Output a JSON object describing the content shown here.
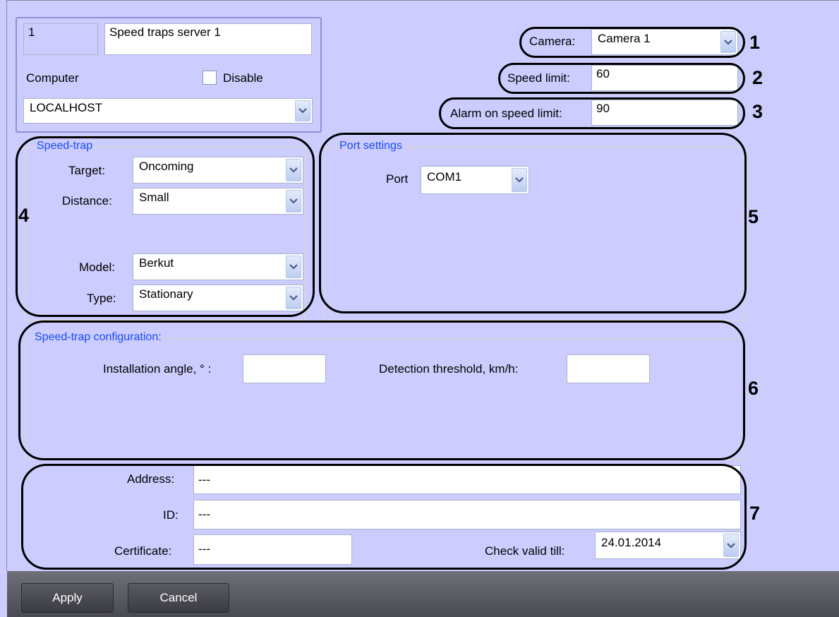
{
  "server": {
    "id": "1",
    "name": "Speed traps server 1",
    "computer_label": "Computer",
    "disable_label": "Disable",
    "disable_checked": false,
    "computer_value": "LOCALHOST"
  },
  "top_right": {
    "camera_label": "Camera:",
    "camera_value": "Camera 1",
    "speed_limit_label": "Speed limit:",
    "speed_limit_value": "60",
    "alarm_label": "Alarm on speed limit:",
    "alarm_value": "90"
  },
  "speed_trap": {
    "title": "Speed-trap",
    "target_label": "Target:",
    "target_value": "Oncoming",
    "distance_label": "Distance:",
    "distance_value": "Small",
    "model_label": "Model:",
    "model_value": "Berkut",
    "type_label": "Type:",
    "type_value": "Stationary"
  },
  "port_settings": {
    "title": "Port settings",
    "port_label": "Port",
    "port_value": "COM1"
  },
  "config": {
    "title": "Speed-trap configuration:",
    "angle_label": "Installation angle, ° :",
    "angle_value": "",
    "threshold_label": "Detection threshold, km/h:",
    "threshold_value": ""
  },
  "bottom": {
    "address_label": "Address:",
    "address_value": "---",
    "id_label": "ID:",
    "id_value": "---",
    "certificate_label": "Certificate:",
    "certificate_value": "---",
    "check_label": "Check valid till:",
    "check_value": "24.01.2014"
  },
  "callouts": [
    "1",
    "2",
    "3",
    "4",
    "5",
    "6",
    "7"
  ],
  "buttons": {
    "apply": "Apply",
    "cancel": "Cancel"
  },
  "colors": {
    "background": "#ccccff",
    "group_title": "#1a4df0",
    "bottom_bar": "#5a5a63"
  }
}
